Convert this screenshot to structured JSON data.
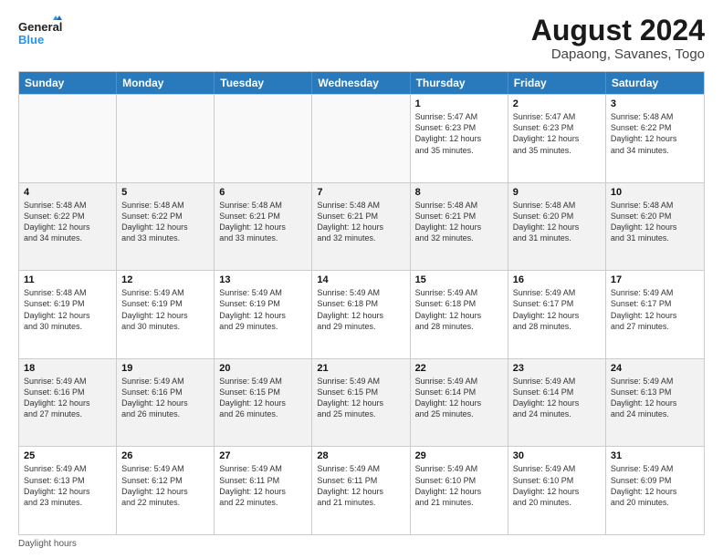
{
  "logo": {
    "text_general": "General",
    "text_blue": "Blue"
  },
  "title": "August 2024",
  "subtitle": "Dapaong, Savanes, Togo",
  "days_of_week": [
    "Sunday",
    "Monday",
    "Tuesday",
    "Wednesday",
    "Thursday",
    "Friday",
    "Saturday"
  ],
  "footer": "Daylight hours",
  "weeks": [
    [
      {
        "day": "",
        "empty": true
      },
      {
        "day": "",
        "empty": true
      },
      {
        "day": "",
        "empty": true
      },
      {
        "day": "",
        "empty": true
      },
      {
        "day": "1",
        "lines": [
          "Sunrise: 5:47 AM",
          "Sunset: 6:23 PM",
          "Daylight: 12 hours",
          "and 35 minutes."
        ]
      },
      {
        "day": "2",
        "lines": [
          "Sunrise: 5:47 AM",
          "Sunset: 6:23 PM",
          "Daylight: 12 hours",
          "and 35 minutes."
        ]
      },
      {
        "day": "3",
        "lines": [
          "Sunrise: 5:48 AM",
          "Sunset: 6:22 PM",
          "Daylight: 12 hours",
          "and 34 minutes."
        ]
      }
    ],
    [
      {
        "day": "4",
        "lines": [
          "Sunrise: 5:48 AM",
          "Sunset: 6:22 PM",
          "Daylight: 12 hours",
          "and 34 minutes."
        ]
      },
      {
        "day": "5",
        "lines": [
          "Sunrise: 5:48 AM",
          "Sunset: 6:22 PM",
          "Daylight: 12 hours",
          "and 33 minutes."
        ]
      },
      {
        "day": "6",
        "lines": [
          "Sunrise: 5:48 AM",
          "Sunset: 6:21 PM",
          "Daylight: 12 hours",
          "and 33 minutes."
        ]
      },
      {
        "day": "7",
        "lines": [
          "Sunrise: 5:48 AM",
          "Sunset: 6:21 PM",
          "Daylight: 12 hours",
          "and 32 minutes."
        ]
      },
      {
        "day": "8",
        "lines": [
          "Sunrise: 5:48 AM",
          "Sunset: 6:21 PM",
          "Daylight: 12 hours",
          "and 32 minutes."
        ]
      },
      {
        "day": "9",
        "lines": [
          "Sunrise: 5:48 AM",
          "Sunset: 6:20 PM",
          "Daylight: 12 hours",
          "and 31 minutes."
        ]
      },
      {
        "day": "10",
        "lines": [
          "Sunrise: 5:48 AM",
          "Sunset: 6:20 PM",
          "Daylight: 12 hours",
          "and 31 minutes."
        ]
      }
    ],
    [
      {
        "day": "11",
        "lines": [
          "Sunrise: 5:48 AM",
          "Sunset: 6:19 PM",
          "Daylight: 12 hours",
          "and 30 minutes."
        ]
      },
      {
        "day": "12",
        "lines": [
          "Sunrise: 5:49 AM",
          "Sunset: 6:19 PM",
          "Daylight: 12 hours",
          "and 30 minutes."
        ]
      },
      {
        "day": "13",
        "lines": [
          "Sunrise: 5:49 AM",
          "Sunset: 6:19 PM",
          "Daylight: 12 hours",
          "and 29 minutes."
        ]
      },
      {
        "day": "14",
        "lines": [
          "Sunrise: 5:49 AM",
          "Sunset: 6:18 PM",
          "Daylight: 12 hours",
          "and 29 minutes."
        ]
      },
      {
        "day": "15",
        "lines": [
          "Sunrise: 5:49 AM",
          "Sunset: 6:18 PM",
          "Daylight: 12 hours",
          "and 28 minutes."
        ]
      },
      {
        "day": "16",
        "lines": [
          "Sunrise: 5:49 AM",
          "Sunset: 6:17 PM",
          "Daylight: 12 hours",
          "and 28 minutes."
        ]
      },
      {
        "day": "17",
        "lines": [
          "Sunrise: 5:49 AM",
          "Sunset: 6:17 PM",
          "Daylight: 12 hours",
          "and 27 minutes."
        ]
      }
    ],
    [
      {
        "day": "18",
        "lines": [
          "Sunrise: 5:49 AM",
          "Sunset: 6:16 PM",
          "Daylight: 12 hours",
          "and 27 minutes."
        ]
      },
      {
        "day": "19",
        "lines": [
          "Sunrise: 5:49 AM",
          "Sunset: 6:16 PM",
          "Daylight: 12 hours",
          "and 26 minutes."
        ]
      },
      {
        "day": "20",
        "lines": [
          "Sunrise: 5:49 AM",
          "Sunset: 6:15 PM",
          "Daylight: 12 hours",
          "and 26 minutes."
        ]
      },
      {
        "day": "21",
        "lines": [
          "Sunrise: 5:49 AM",
          "Sunset: 6:15 PM",
          "Daylight: 12 hours",
          "and 25 minutes."
        ]
      },
      {
        "day": "22",
        "lines": [
          "Sunrise: 5:49 AM",
          "Sunset: 6:14 PM",
          "Daylight: 12 hours",
          "and 25 minutes."
        ]
      },
      {
        "day": "23",
        "lines": [
          "Sunrise: 5:49 AM",
          "Sunset: 6:14 PM",
          "Daylight: 12 hours",
          "and 24 minutes."
        ]
      },
      {
        "day": "24",
        "lines": [
          "Sunrise: 5:49 AM",
          "Sunset: 6:13 PM",
          "Daylight: 12 hours",
          "and 24 minutes."
        ]
      }
    ],
    [
      {
        "day": "25",
        "lines": [
          "Sunrise: 5:49 AM",
          "Sunset: 6:13 PM",
          "Daylight: 12 hours",
          "and 23 minutes."
        ]
      },
      {
        "day": "26",
        "lines": [
          "Sunrise: 5:49 AM",
          "Sunset: 6:12 PM",
          "Daylight: 12 hours",
          "and 22 minutes."
        ]
      },
      {
        "day": "27",
        "lines": [
          "Sunrise: 5:49 AM",
          "Sunset: 6:11 PM",
          "Daylight: 12 hours",
          "and 22 minutes."
        ]
      },
      {
        "day": "28",
        "lines": [
          "Sunrise: 5:49 AM",
          "Sunset: 6:11 PM",
          "Daylight: 12 hours",
          "and 21 minutes."
        ]
      },
      {
        "day": "29",
        "lines": [
          "Sunrise: 5:49 AM",
          "Sunset: 6:10 PM",
          "Daylight: 12 hours",
          "and 21 minutes."
        ]
      },
      {
        "day": "30",
        "lines": [
          "Sunrise: 5:49 AM",
          "Sunset: 6:10 PM",
          "Daylight: 12 hours",
          "and 20 minutes."
        ]
      },
      {
        "day": "31",
        "lines": [
          "Sunrise: 5:49 AM",
          "Sunset: 6:09 PM",
          "Daylight: 12 hours",
          "and 20 minutes."
        ]
      }
    ]
  ]
}
